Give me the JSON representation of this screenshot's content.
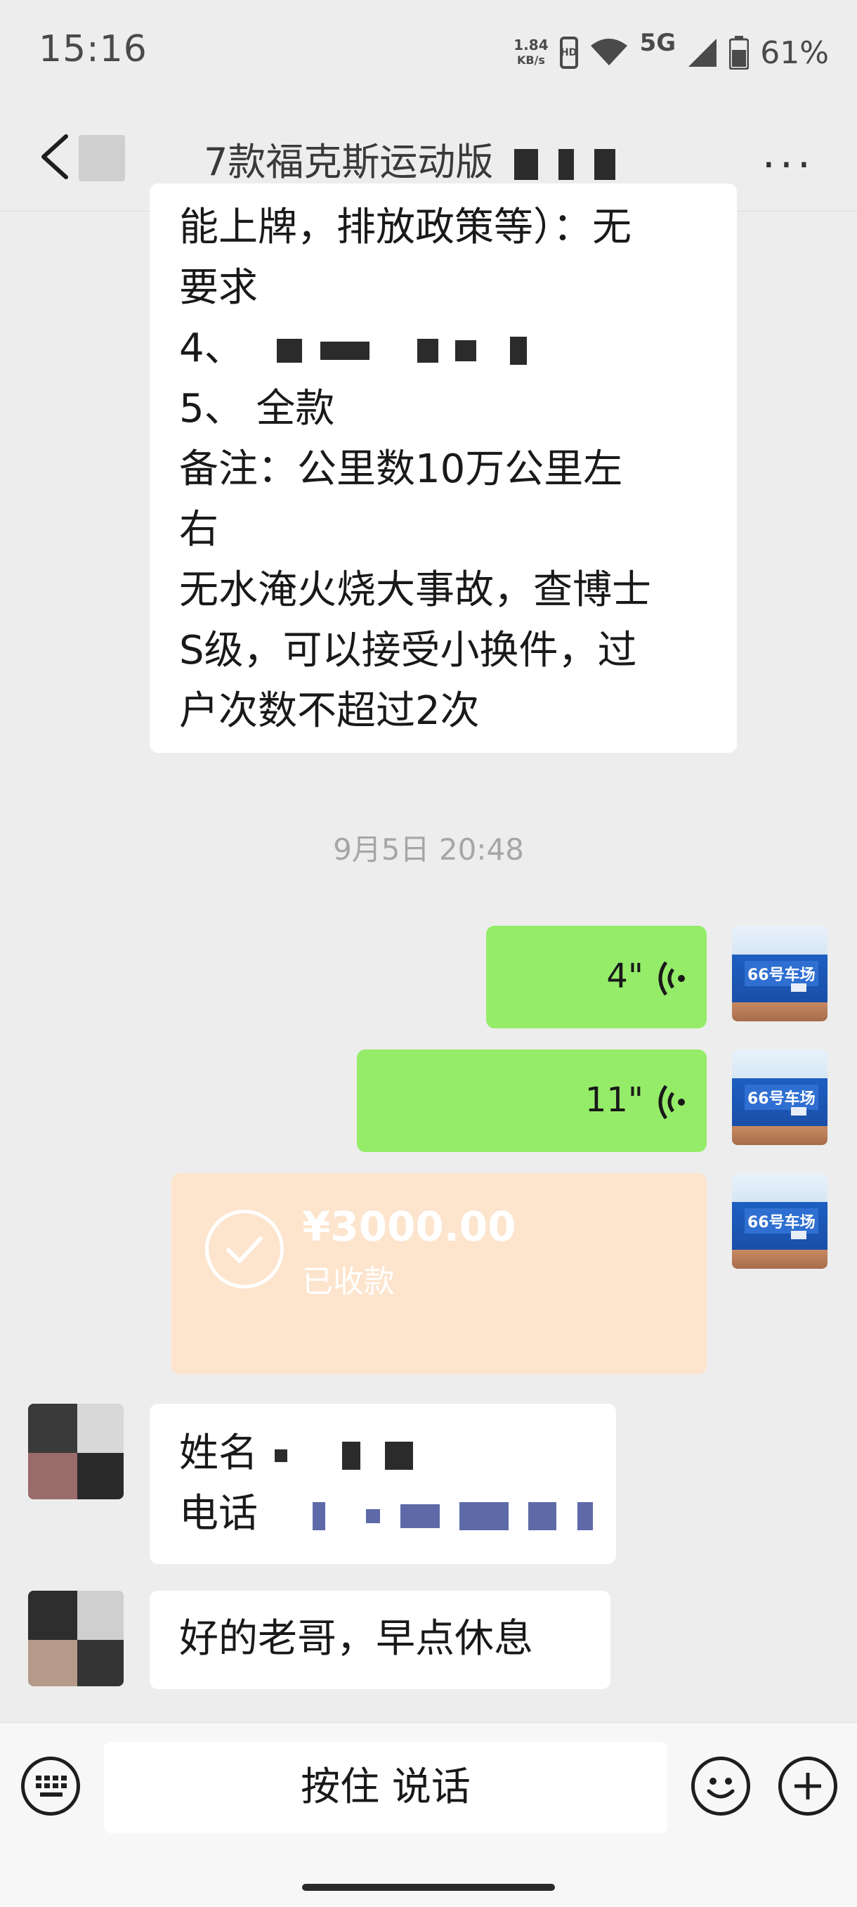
{
  "status_bar": {
    "time": "15:16",
    "net_speed_value": "1.84",
    "net_speed_unit": "KB/s",
    "hd_label": "HD",
    "network": "5G",
    "battery": "61%"
  },
  "nav": {
    "title_visible": "7款福克斯运动版",
    "more_label": "···"
  },
  "messages": {
    "m1_lines": [
      "能上牌，排放政策等）：无",
      "要求",
      "4、",
      "5、 全款",
      "备注：公里数10万公里左",
      "右",
      "无水淹火烧大事故，查博士",
      "S级，可以接受小换件，过",
      "户次数不超过2次"
    ],
    "timestamp": "9月5日 20:48",
    "voice1_duration": "4\"",
    "voice2_duration": "11\"",
    "transfer_amount": "¥3000.00",
    "transfer_status": "已收款",
    "store_sign": "66号车场",
    "m4_name_label": "姓名",
    "m4_phone_label": "电话",
    "m5_text": "好的老哥，早点休息"
  },
  "bottom_bar": {
    "hold_to_talk": "按住 说话"
  },
  "colors": {
    "chat_bg": "#ededed",
    "outgoing_bubble": "#95ec69",
    "incoming_bubble": "#ffffff",
    "transfer_bubble": "#fde4cd"
  }
}
